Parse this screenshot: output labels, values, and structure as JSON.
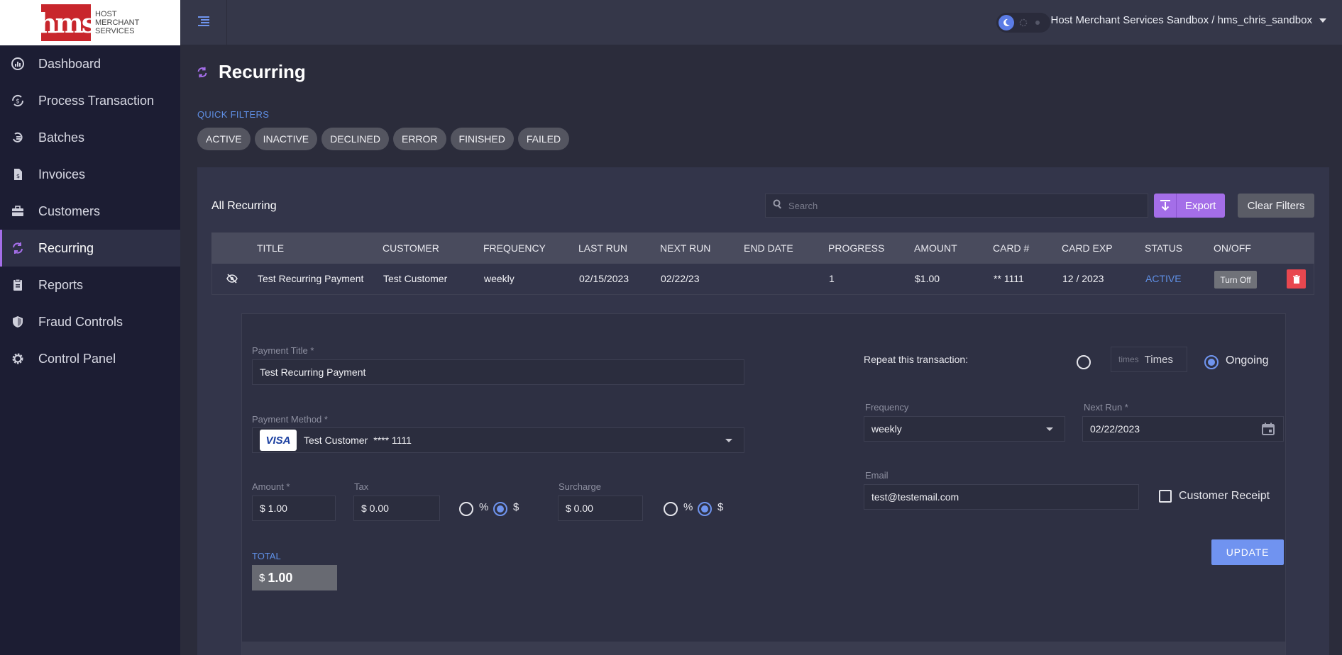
{
  "brand": {
    "logo_mark": "hms",
    "logo_line1": "Host",
    "logo_line2": "Merchant",
    "logo_line3": "Services"
  },
  "sidebar": {
    "items": [
      {
        "label": "Dashboard",
        "icon": "dashboard-icon"
      },
      {
        "label": "Process Transaction",
        "icon": "process-transaction-icon"
      },
      {
        "label": "Batches",
        "icon": "batches-icon"
      },
      {
        "label": "Invoices",
        "icon": "invoice-icon"
      },
      {
        "label": "Customers",
        "icon": "briefcase-icon"
      },
      {
        "label": "Recurring",
        "icon": "recurring-icon"
      },
      {
        "label": "Reports",
        "icon": "clipboard-icon"
      },
      {
        "label": "Fraud Controls",
        "icon": "shield-icon"
      },
      {
        "label": "Control Panel",
        "icon": "gear-icon"
      }
    ],
    "active_index": 5
  },
  "topbar": {
    "account_label": "Host Merchant Services Sandbox / hms_chris_sandbox"
  },
  "page": {
    "title": "Recurring",
    "quick_filters_label": "QUICK FILTERS",
    "quick_filters": [
      "ACTIVE",
      "INACTIVE",
      "DECLINED",
      "ERROR",
      "FINISHED",
      "FAILED"
    ]
  },
  "list": {
    "title": "All Recurring",
    "search_placeholder": "Search",
    "export_label": "Export",
    "clear_filters_label": "Clear Filters",
    "columns": [
      "Title",
      "Customer",
      "Frequency",
      "Last Run",
      "Next Run",
      "End Date",
      "Progress",
      "Amount",
      "Card #",
      "Card Exp",
      "Status",
      "On/Off"
    ],
    "rows": [
      {
        "title": "Test Recurring Payment",
        "customer": "Test Customer",
        "frequency": "weekly",
        "last_run": "02/15/2023",
        "next_run": "02/22/23",
        "end_date": "",
        "progress": "1",
        "amount": "$1.00",
        "card": "** 1111",
        "card_exp": "12 / 2023",
        "status": "ACTIVE",
        "toggle_label": "Turn Off"
      }
    ]
  },
  "detail": {
    "payment_title_label": "Payment Title *",
    "payment_title_value": "Test Recurring Payment",
    "payment_method_label": "Payment Method *",
    "card_brand": "VISA",
    "payment_method_name": "Test Customer",
    "payment_method_card": "**** 1111",
    "amount_label": "Amount *",
    "amount_value": "$ 1.00",
    "tax_label": "Tax",
    "tax_value": "$ 0.00",
    "tax_mode": "$",
    "surcharge_label": "Surcharge",
    "surcharge_value": "$ 0.00",
    "surcharge_mode": "$",
    "percent_symbol": "%",
    "dollar_symbol": "$",
    "total_label": "TOTAL",
    "total_symbol": "$",
    "total_value": "1.00",
    "repeat_label": "Repeat this transaction:",
    "times_placeholder": "times",
    "times_label": "Times",
    "ongoing_label": "Ongoing",
    "repeat_mode": "Ongoing",
    "frequency_label": "Frequency",
    "frequency_value": "weekly",
    "next_run_label": "Next Run *",
    "next_run_value": "02/22/2023",
    "email_label": "Email",
    "email_value": "test@testemail.com",
    "customer_receipt_label": "Customer Receipt",
    "customer_receipt_checked": false,
    "update_label": "UPDATE"
  },
  "colors": {
    "accent_purple": "#a46ee8",
    "accent_blue": "#5f8fe5",
    "danger": "#e8474f",
    "brand_red": "#c8262c"
  }
}
